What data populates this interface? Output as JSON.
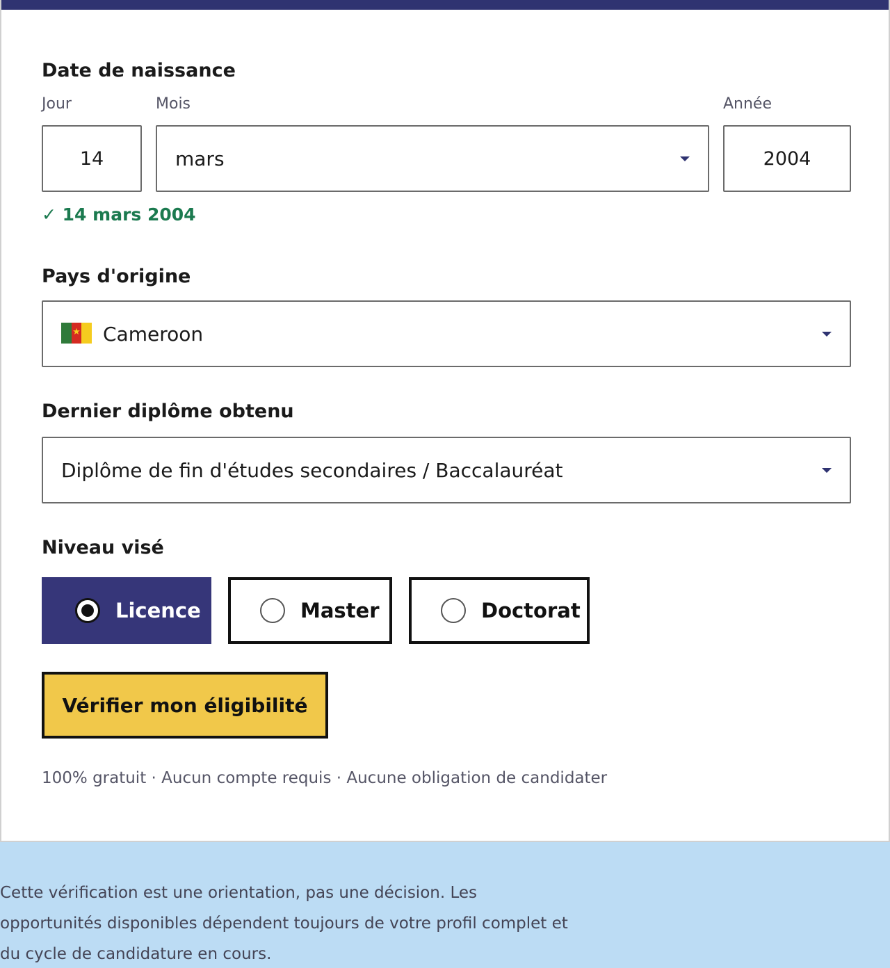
{
  "form": {
    "birthdate": {
      "title": "Date de naissance",
      "day_label": "Jour",
      "month_label": "Mois",
      "year_label": "Année",
      "day_value": "14",
      "month_value": "mars",
      "year_value": "2004",
      "confirmation": "✓ 14 mars 2004"
    },
    "country": {
      "title": "Pays d'origine",
      "value": "Cameroon",
      "flag_icon": "cameroon-flag"
    },
    "diploma": {
      "title": "Dernier diplôme obtenu",
      "value": "Diplôme de fin d'études secondaires / Baccalauréat"
    },
    "level": {
      "title": "Niveau visé",
      "options": [
        {
          "label": "Licence",
          "selected": true
        },
        {
          "label": "Master",
          "selected": false
        },
        {
          "label": "Doctorat",
          "selected": false
        }
      ]
    },
    "submit_label": "Vérifier mon éligibilité",
    "fineprint": "100% gratuit · Aucun compte requis · Aucune obligation de candidater"
  },
  "disclaimer": "Cette vérification est une orientation, pas une décision. Les opportunités disponibles dépendent toujours de votre profil complet et du cycle de candidature en cours.",
  "colors": {
    "accent": "#363679",
    "cta": "#f1c84a",
    "success": "#1b7a4f",
    "page_bg": "#bcdcf4"
  }
}
